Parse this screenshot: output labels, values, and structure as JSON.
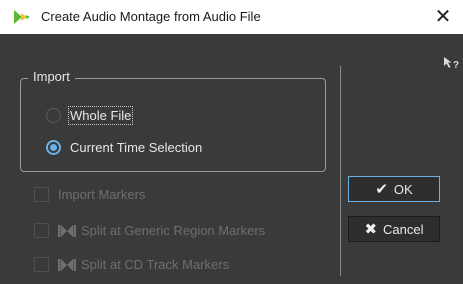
{
  "window": {
    "title": "Create Audio Montage from Audio File",
    "close_glyph": "✕",
    "app_icon": "wavelab-logo-icon",
    "help_icon": "context-help-icon"
  },
  "import_group": {
    "title": "Import",
    "options": [
      {
        "label": "Whole File",
        "selected": false
      },
      {
        "label": "Current Time Selection",
        "selected": true
      }
    ]
  },
  "checkboxes": [
    {
      "label": "Import Markers",
      "checked": false,
      "enabled": false,
      "icon": null
    },
    {
      "label": "Split at Generic Region Markers",
      "checked": false,
      "enabled": false,
      "icon": "region-marker-icon"
    },
    {
      "label": "Split at CD Track Markers",
      "checked": false,
      "enabled": false,
      "icon": "cd-track-marker-icon"
    }
  ],
  "buttons": {
    "ok_label": "OK",
    "ok_glyph": "✔",
    "cancel_label": "Cancel",
    "cancel_glyph": "✖"
  },
  "colors": {
    "accent": "#6ab1e8",
    "background": "#3a3a3a",
    "disabled_text": "#6e6e6e",
    "logo_green": "#5bb932",
    "logo_yellow": "#f2c12e"
  }
}
